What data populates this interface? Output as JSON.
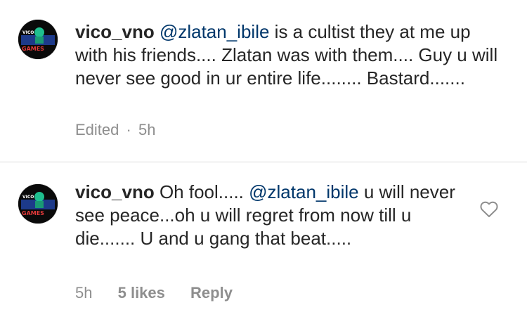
{
  "comments": [
    {
      "username": "vico_vno",
      "mention": "@zlatan_ibile",
      "text_before": "",
      "text_after": " is a cultist they at me up with his friends.... Zlatan was with them.... Guy u will never see good in ur entire life........ Bastard.......",
      "edited_label": "Edited",
      "separator": "·",
      "timestamp": "5h",
      "avatar_text": "GAMES"
    },
    {
      "username": "vico_vno",
      "mention": "@zlatan_ibile",
      "text_before": "Oh fool..... ",
      "text_after": " u will never see peace...oh u will regret from now till u die....... U and u gang that beat.....",
      "timestamp": "5h",
      "likes": "5 likes",
      "reply_label": "Reply",
      "like_icon": "heart-outline-icon",
      "avatar_text": "GAMES"
    }
  ],
  "colors": {
    "text": "#262626",
    "mention": "#00376b",
    "meta": "#8e8e8e",
    "divider": "#dbdbdb"
  }
}
